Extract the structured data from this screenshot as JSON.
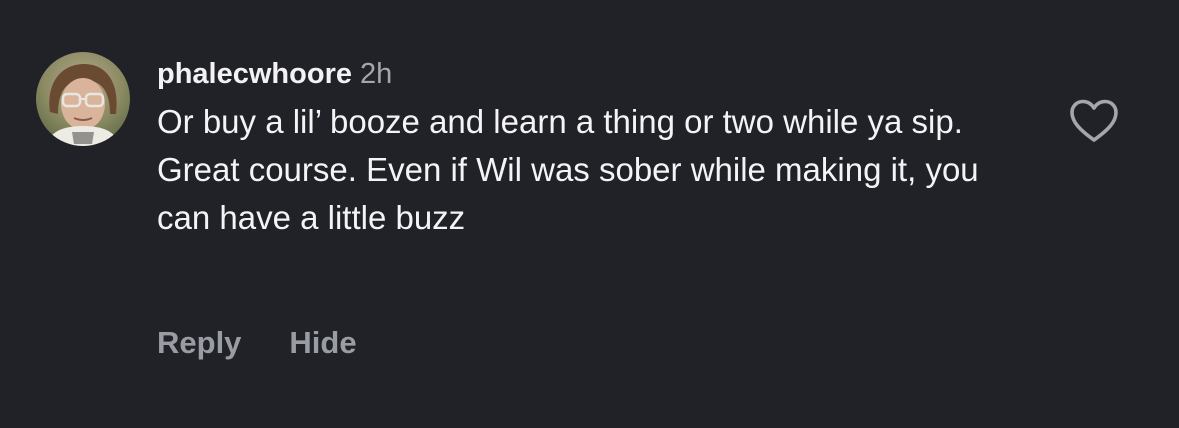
{
  "comment": {
    "username": "phalecwhoore",
    "time": "2h",
    "text": "Or buy a lil’ booze and learn a thing or two while ya sip. Great course. Even if Wil was sober while making it, you can have a little buzz",
    "avatar_icon": "user-avatar-photo",
    "like_icon": "heart-outline-icon"
  },
  "actions": {
    "reply_label": "Reply",
    "hide_label": "Hide"
  },
  "colors": {
    "background": "#212227",
    "username": "#f2f2f4",
    "muted": "#a4a6ad",
    "text": "#f4f4f6"
  }
}
